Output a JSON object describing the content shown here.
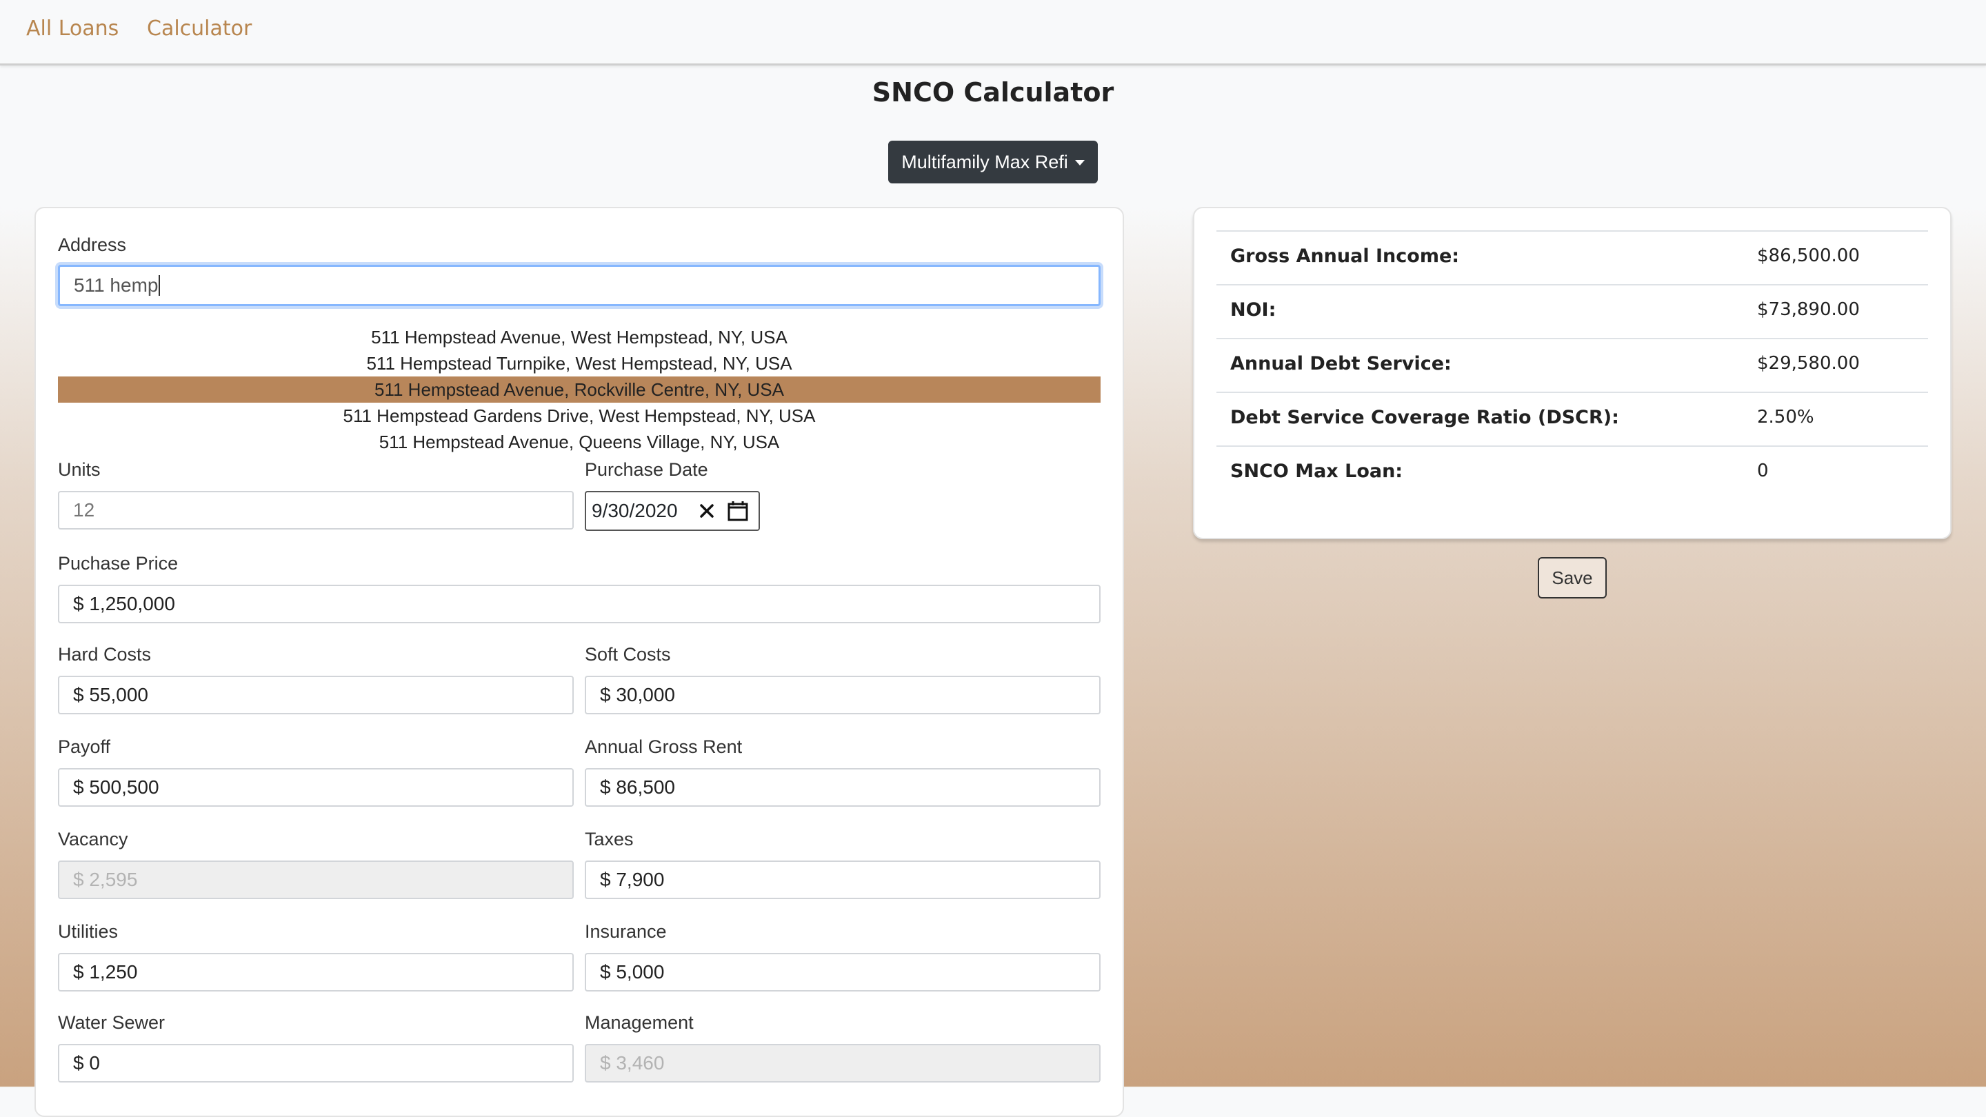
{
  "nav": {
    "all_loans": "All Loans",
    "calculator": "Calculator"
  },
  "page_title": "SNCO Calculator",
  "loan_type_dropdown": {
    "selected": "Multifamily Max Refi"
  },
  "form": {
    "address": {
      "label": "Address",
      "value": "511 hemp"
    },
    "suggestions": [
      "511 Hempstead Avenue, West Hempstead, NY, USA",
      "511 Hempstead Turnpike, West Hempstead, NY, USA",
      "511 Hempstead Avenue, Rockville Centre, NY, USA",
      "511 Hempstead Gardens Drive, West Hempstead, NY, USA",
      "511 Hempstead Avenue, Queens Village, NY, USA"
    ],
    "units": {
      "label": "Units",
      "value": "12"
    },
    "purchase_date": {
      "label": "Purchase Date",
      "value": "9/30/2020"
    },
    "purchase_price": {
      "label": "Puchase Price",
      "value": "$ 1,250,000"
    },
    "hard_costs": {
      "label": "Hard Costs",
      "value": "$ 55,000"
    },
    "soft_costs": {
      "label": "Soft Costs",
      "value": "$ 30,000"
    },
    "payoff": {
      "label": "Payoff",
      "value": "$ 500,500"
    },
    "annual_gross_rent": {
      "label": "Annual Gross Rent",
      "value": "$ 86,500"
    },
    "vacancy": {
      "label": "Vacancy",
      "value": "$ 2,595"
    },
    "taxes": {
      "label": "Taxes",
      "value": "$ 7,900"
    },
    "utilities": {
      "label": "Utilities",
      "value": "$ 1,250"
    },
    "insurance": {
      "label": "Insurance",
      "value": "$ 5,000"
    },
    "water_sewer": {
      "label": "Water Sewer",
      "value": "$ 0"
    },
    "management": {
      "label": "Management",
      "value": "$ 3,460"
    }
  },
  "summary": [
    {
      "label": "Gross Annual Income:",
      "value": "$86,500.00"
    },
    {
      "label": "NOI:",
      "value": "$73,890.00"
    },
    {
      "label": "Annual Debt Service:",
      "value": "$29,580.00"
    },
    {
      "label": "Debt Service Coverage Ratio (DSCR):",
      "value": "2.50%"
    },
    {
      "label": "SNCO Max Loan:",
      "value": "0"
    }
  ],
  "save_label": "Save",
  "colors": {
    "accent": "#b8864f",
    "active_suggestion": "#b8865a",
    "dark_button": "#343a40"
  }
}
